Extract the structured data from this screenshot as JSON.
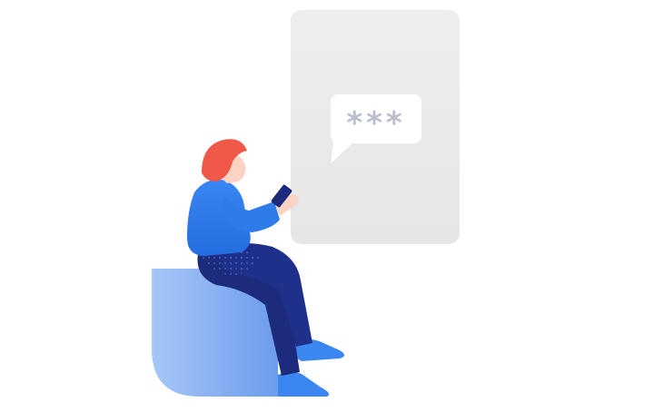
{
  "illustration": {
    "bubble_text": "***"
  },
  "colors": {
    "panel": "#ececec",
    "bubble": "#ffffff",
    "bubble_text": "#b9bfcc",
    "seat_light": "#9fc1f5",
    "seat_dark": "#5f93ea",
    "sweater": "#2f7bea",
    "pants": "#1b2a7a",
    "shoes": "#3b86f0",
    "hair": "#f0584a",
    "skin": "#fbd3c4",
    "phone": "#1b2a7a"
  },
  "icons": {
    "phone": "phone-icon"
  }
}
